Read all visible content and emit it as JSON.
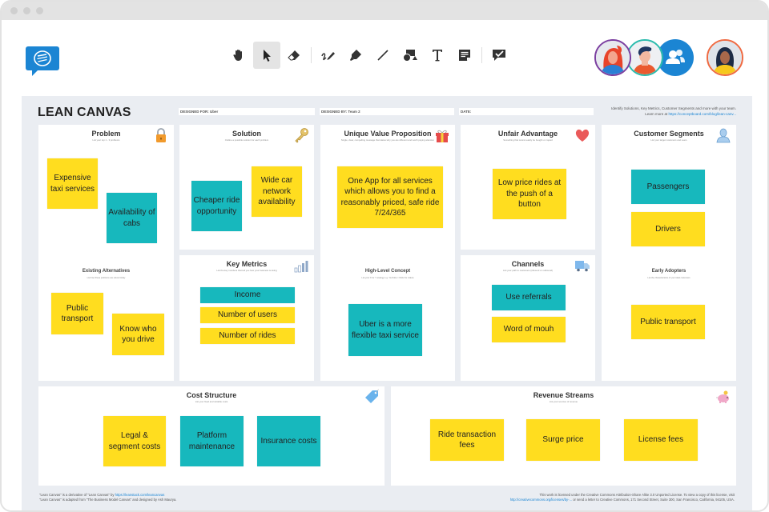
{
  "window": {
    "controls": [
      "close",
      "minimize",
      "maximize"
    ]
  },
  "app": {
    "logo_icon": "speech-bubble-logo-icon"
  },
  "toolbar": {
    "tools": [
      {
        "name": "pan",
        "icon": "hand-icon",
        "active": false
      },
      {
        "name": "select",
        "icon": "cursor-arrow-icon",
        "active": true
      },
      {
        "name": "eraser",
        "icon": "eraser-icon",
        "active": false
      },
      {
        "name": "pen",
        "icon": "pen-icon",
        "active": false
      },
      {
        "name": "highlighter",
        "icon": "highlighter-icon",
        "active": false
      },
      {
        "name": "line",
        "icon": "line-icon",
        "active": false
      },
      {
        "name": "shapes",
        "icon": "shapes-icon",
        "active": false
      },
      {
        "name": "text",
        "icon": "text-icon",
        "active": false
      },
      {
        "name": "sticky-note",
        "icon": "sticky-note-icon",
        "active": false
      },
      {
        "name": "feedback",
        "icon": "comment-check-icon",
        "active": false
      }
    ]
  },
  "participants": {
    "avatars": [
      "avatar-red-hair-woman",
      "avatar-man-dark-hair",
      "group-users-icon",
      "avatar-woman-yellow-shirt"
    ]
  },
  "board": {
    "title": "LEAN CANVAS",
    "designed_for": "DESIGNED FOR: Uber",
    "designed_by": "DESIGNED BY: Team 2",
    "date": "DATE:",
    "note_line1": "Identify Solutions, Key Metrics, Customer Segments and more with your team.",
    "note_line2_prefix": "Learn more at ",
    "note_line2_link": "https://conceptboard.com/blog/lean-canv..."
  },
  "sections": {
    "problem": {
      "title": "Problem",
      "subtitle": "List your top 1 - 3 problems",
      "notes": [
        "Expensive taxi services",
        "Availability of cabs"
      ],
      "sub_title": "Existing Alternatives",
      "sub_subtitle": "List how these problems are solved today",
      "sub_notes": [
        "Public transport",
        "Know who you drive"
      ]
    },
    "solution": {
      "title": "Solution",
      "subtitle": "Outline a possible solution for each problem",
      "notes": [
        "Cheaper ride opportunity",
        "Wide car network availability"
      ]
    },
    "key_metrics": {
      "title": "Key Metrics",
      "subtitle": "List the key numbers that tell you how your business is doing",
      "notes": [
        "Income",
        "Number of users",
        "Number of rides"
      ]
    },
    "uvp": {
      "title": "Unique Value Proposition",
      "subtitle": "Single, clear, compelling message that states why you are different and worth paying attention",
      "notes": [
        "One App for all services which allows you to find a reasonably priced, safe ride 7/24/365"
      ],
      "sub_title": "High-Level Concept",
      "sub_subtitle": "List your X for Y analogy e.g. YouTube = Flickr for videos",
      "sub_notes": [
        "Uber is a more flexible taxi service"
      ]
    },
    "unfair_advantage": {
      "title": "Unfair Advantage",
      "subtitle": "Something that cannot easily be bought or copied",
      "notes": [
        "Low price rides at the push of a button"
      ]
    },
    "channels": {
      "title": "Channels",
      "subtitle": "List your path to customers (inbound or outbound)",
      "notes": [
        "Use referrals",
        "Word of mouh"
      ]
    },
    "customer_segments": {
      "title": "Customer Segments",
      "subtitle": "List your target customers and users",
      "notes": [
        "Passengers",
        "Drivers"
      ],
      "sub_title": "Early Adopters",
      "sub_subtitle": "List the characteristics of your ideal customers",
      "sub_notes": [
        "Public transport"
      ]
    },
    "cost_structure": {
      "title": "Cost Structure",
      "subtitle": "List your fixed and variable costs",
      "notes": [
        "Legal & segment costs",
        "Platform maintenance",
        "Insurance costs"
      ]
    },
    "revenue_streams": {
      "title": "Revenue Streams",
      "subtitle": "List your sources of revenue",
      "notes": [
        "Ride transaction fees",
        "Surge price",
        "License fees"
      ]
    }
  },
  "footer": {
    "left_line1_prefix": "\"Lean Canvas\" is a derivative of \"Lean Canvas\" by ",
    "left_line1_link": "https://leanstack.com/leancanvas",
    "left_line2": "\"Lean Canvas\" is adapted from \"The Business Model Canvas\" and designed by Ash Maurya.",
    "right_line1": "This work is licensed under the Creative Commons Attribution-Share Alike 3.0 Unported License. To view a copy of this license, visit",
    "right_line2_link": "http://creativecommons.org/licenses/by-...",
    "right_line2_suffix": " or send a letter to Creative Commons, 171 Second Street, Suite 300, San Francisco, California, 94105, USA."
  },
  "colors": {
    "sticky_yellow": "#ffdd1f",
    "sticky_teal": "#17b8bd",
    "accent_blue": "#1b85d3",
    "board_bg": "#eaedf2"
  }
}
